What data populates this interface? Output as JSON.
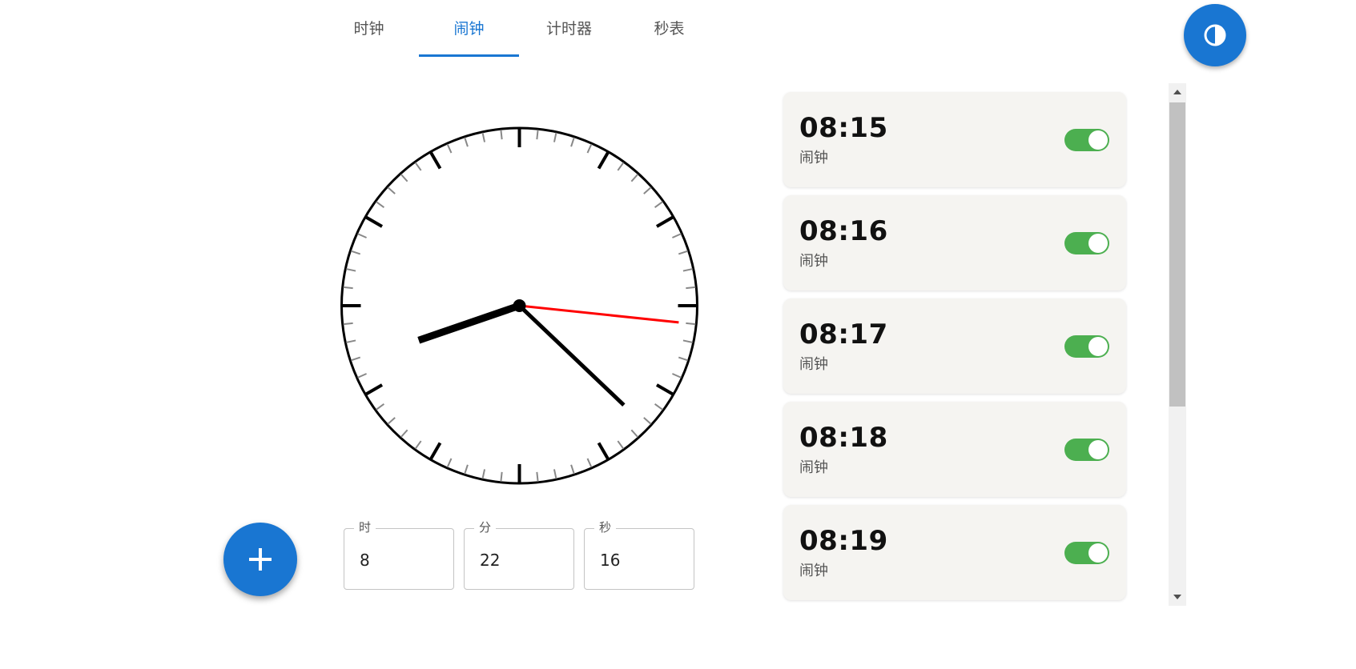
{
  "tabs": [
    {
      "label": "时钟"
    },
    {
      "label": "闹钟"
    },
    {
      "label": "计时器"
    },
    {
      "label": "秒表"
    }
  ],
  "active_tab": "闹钟",
  "clock": {
    "hours": 8,
    "minutes": 22,
    "seconds": 16
  },
  "time_inputs": {
    "hour": {
      "label": "时",
      "value": "8"
    },
    "minute": {
      "label": "分",
      "value": "22"
    },
    "second": {
      "label": "秒",
      "value": "16"
    }
  },
  "alarms": [
    {
      "time": "08:15",
      "label": "闹钟",
      "enabled": true
    },
    {
      "time": "08:16",
      "label": "闹钟",
      "enabled": true
    },
    {
      "time": "08:17",
      "label": "闹钟",
      "enabled": true
    },
    {
      "time": "08:18",
      "label": "闹钟",
      "enabled": true
    },
    {
      "time": "08:19",
      "label": "闹钟",
      "enabled": true
    }
  ],
  "icons": {
    "theme_toggle": "contrast-icon",
    "add": "plus-icon"
  },
  "colors": {
    "primary": "#1976d2",
    "toggle_on": "#4caf50",
    "second_hand": "#ff0000",
    "card_bg": "#f5f4f1"
  }
}
